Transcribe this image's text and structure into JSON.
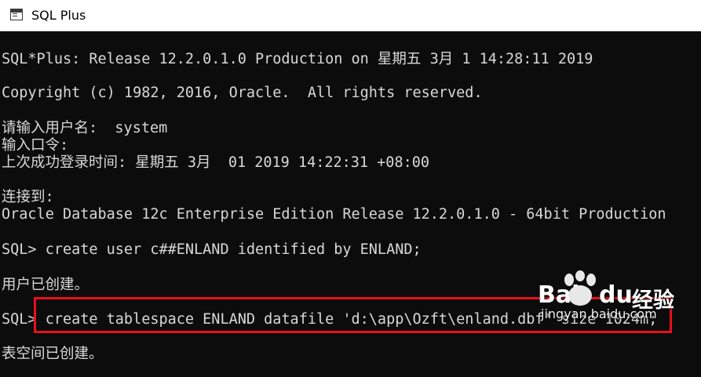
{
  "window": {
    "title": "SQL Plus",
    "icon": "console-window-icon",
    "colors": {
      "console_background": "#0c0c0c",
      "console_text": "#d8d8d8",
      "highlight_border": "#e8101c"
    }
  },
  "console": {
    "lines": [
      "SQL*Plus: Release 12.2.0.1.0 Production on 星期五 3月 1 14:28:11 2019",
      "Copyright (c) 1982, 2016, Oracle.  All rights reserved.",
      "请输入用户名:  system",
      "输入口令:",
      "上次成功登录时间: 星期五 3月  01 2019 14:22:31 +08:00",
      "连接到:",
      "Oracle Database 12c Enterprise Edition Release 12.2.0.1.0 - 64bit Production",
      "SQL> create user c##ENLAND identified by ENLAND;",
      "用户已创建。",
      "SQL> create tablespace ENLAND datafile 'd:\\app\\Ozft\\enland.dbf' size 1024m;",
      "表空间已创建。"
    ]
  },
  "watermark": {
    "logo_left": "Bai",
    "logo_right": "du",
    "logo_cn": "经验",
    "url": "jingyan.baidu.com",
    "icon": "paw-icon"
  }
}
